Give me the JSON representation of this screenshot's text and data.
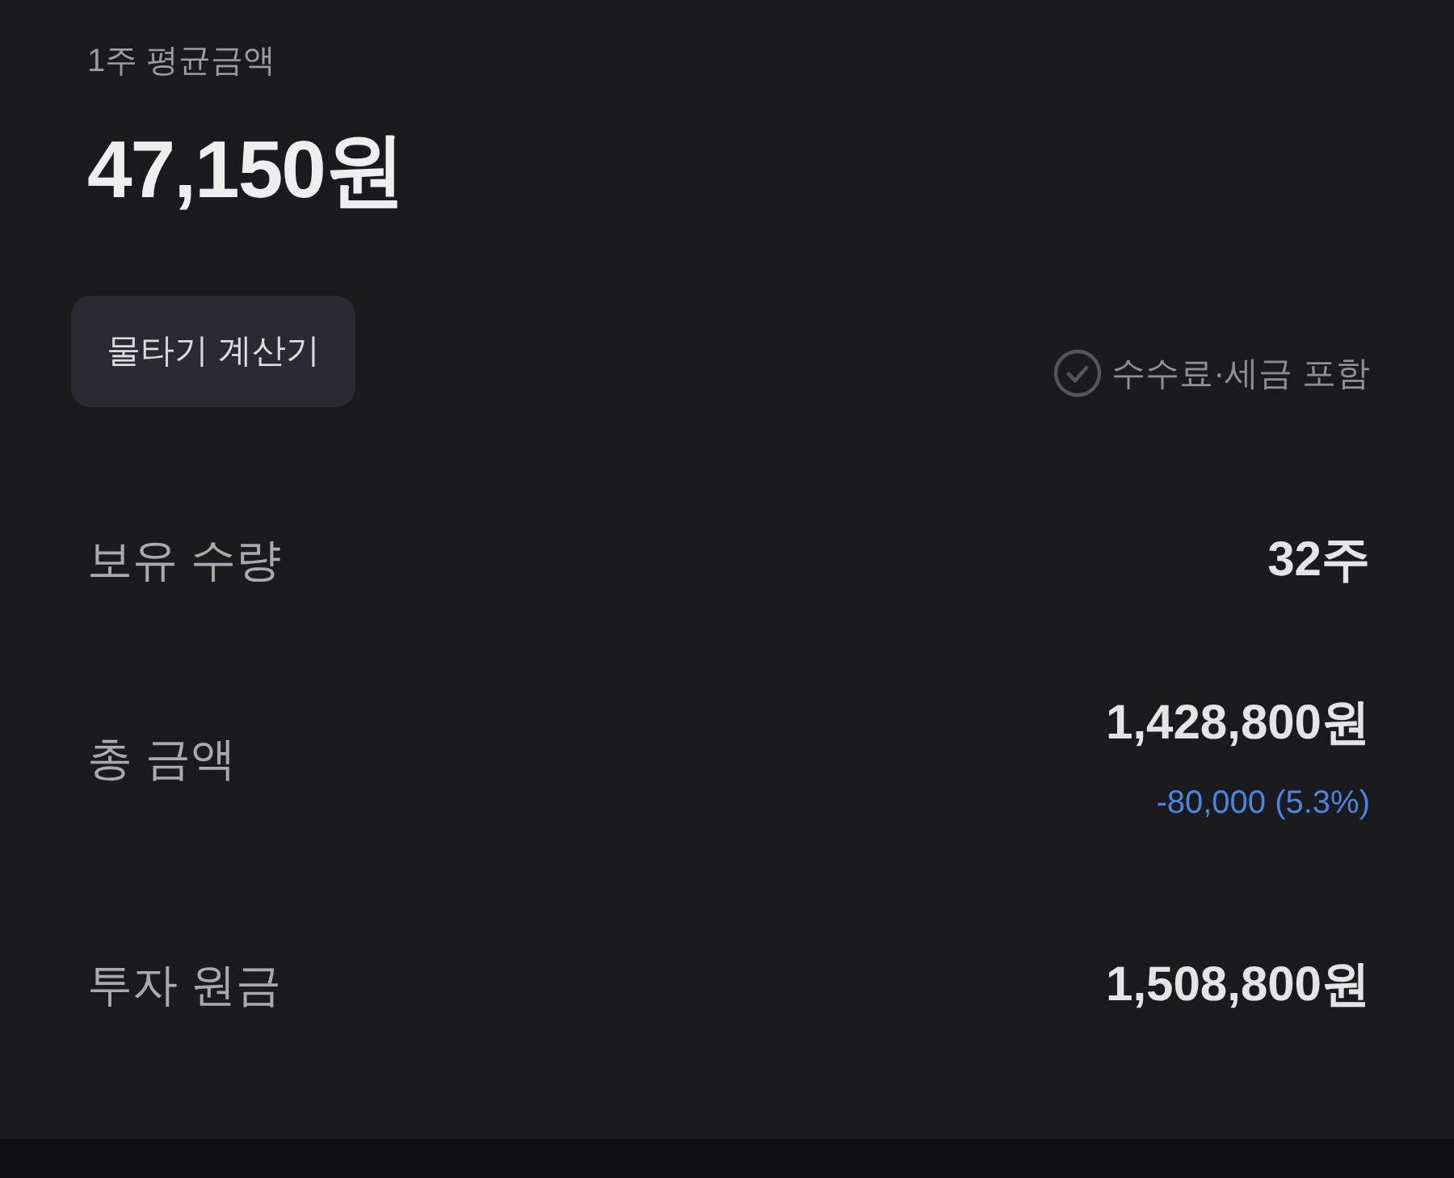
{
  "average": {
    "label": "1주 평균금액",
    "value": "47,150원"
  },
  "calculator_button": {
    "label": "물타기 계산기"
  },
  "fee_tax_option": {
    "label": "수수료·세금 포함",
    "checked": false
  },
  "rows": [
    {
      "label": "보유 수량",
      "value": "32주"
    },
    {
      "label": "총 금액",
      "value": "1,428,800원",
      "change": "-80,000 (5.3%)",
      "negative": true
    },
    {
      "label": "투자 원금",
      "value": "1,508,800원"
    }
  ]
}
